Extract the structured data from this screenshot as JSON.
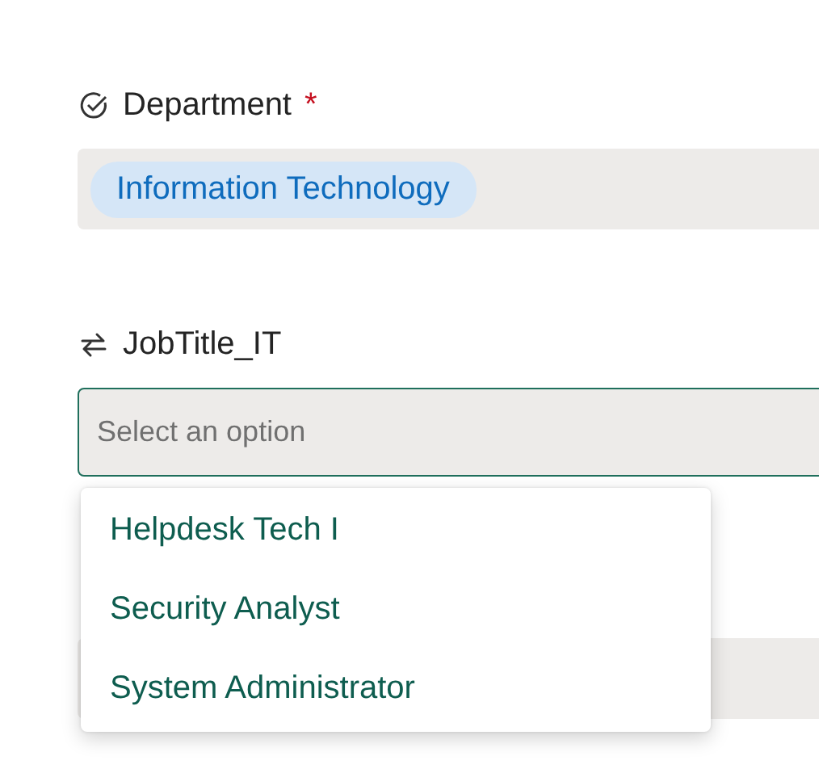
{
  "department": {
    "label": "Department",
    "required_mark": "*",
    "value_tag": "Information Technology"
  },
  "job_title": {
    "label": "JobTitle_IT",
    "placeholder": "Select an option",
    "focused": true,
    "options": [
      {
        "label": "Helpdesk Tech I",
        "selected": false
      },
      {
        "label": "Security Analyst",
        "selected": false
      },
      {
        "label": "System Administrator",
        "selected": false
      }
    ]
  }
}
